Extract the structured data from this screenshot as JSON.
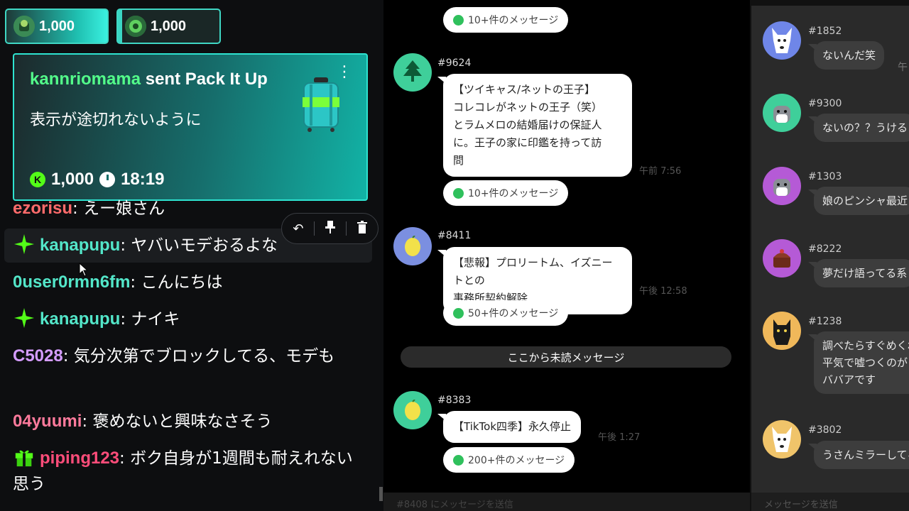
{
  "left": {
    "leaders": [
      {
        "amount": "1,000"
      },
      {
        "amount": "1,000"
      }
    ],
    "gift": {
      "username": "kannriomama",
      "sent_label": "sent",
      "gift_name": "Pack It Up",
      "message": "表示が途切れないように",
      "amount": "1,000",
      "time_left": "18:19"
    },
    "messages": [
      {
        "user": "ezorisu",
        "color": "#ff6b6b",
        "sep": ": ",
        "text": "えー娘さん"
      },
      {
        "user": "kanapupu",
        "color": "#53e6c9",
        "sep": ": ",
        "text": "ヤバいモデおるよな"
      },
      {
        "user": "0user0rmn6fm",
        "color": "#53e6c9",
        "sep": ": ",
        "text": "こんにちは"
      },
      {
        "user": "kanapupu",
        "color": "#53e6c9",
        "sep": ": ",
        "text": "ナイキ"
      },
      {
        "user": "C5028",
        "color": "#d49cff",
        "sep": ": ",
        "text": "気分次第でブロックしてる、モデも"
      },
      {
        "user": "04yuumi",
        "color": "#ff7a9c",
        "sep": ": ",
        "text": "褒めないと興味なさそう"
      },
      {
        "user": "piping123",
        "color": "#ff4d7a",
        "sep": ": ",
        "text": "ボク自身が1週間も耐えれない思う"
      }
    ]
  },
  "middle": {
    "top_count": "10+件のメッセージ",
    "posts": [
      {
        "id": "#9624",
        "text_lines": [
          "【ツイキャス/ネットの王子】",
          "コレコレがネットの王子（笑）",
          "とラムメロの結婚届けの保証人",
          "に。王子の家に印鑑を持って訪",
          "問"
        ],
        "time": "午前 7:56",
        "count": "10+件のメッセージ",
        "avatar_color": "#3fcf9a"
      },
      {
        "id": "#8411",
        "text_lines": [
          "【悲報】プロリートム、イズニートとの",
          "事務所契約解除"
        ],
        "time": "午後 12:58",
        "count": "50+件のメッセージ",
        "avatar_color": "#7b8fe0"
      },
      {
        "id": "#8383",
        "text_lines": [
          "【TikTok四季】永久停止"
        ],
        "time": "午後 1:27",
        "count": "200+件のメッセージ",
        "avatar_color": "#3fcf9a"
      }
    ],
    "unread_divider": "ここから未読メッセージ",
    "bottom_hint": "#8408 にメッセージを送信"
  },
  "right": {
    "posts": [
      {
        "id": "#1852",
        "text": "ないんだ笑",
        "avatar_color": "#6f86e8",
        "extra": "午"
      },
      {
        "id": "#9300",
        "text": "ないの？？うける",
        "avatar_color": "#3fcf9a"
      },
      {
        "id": "#1303",
        "text": "娘のピンシャ最近",
        "avatar_color": "#b55ad6"
      },
      {
        "id": "#8222",
        "text": "夢だけ語ってる系",
        "avatar_color": "#b55ad6"
      },
      {
        "id": "#1238",
        "text_lines": [
          "調べたらすぐめくれ",
          "平気で嘘つくのが",
          "ババアです"
        ],
        "avatar_color": "#f0b85a"
      },
      {
        "id": "#3802",
        "text": "うさんミラーしてる",
        "avatar_color": "#f0c46a"
      }
    ],
    "bottom_hint": "メッセージを送信"
  }
}
